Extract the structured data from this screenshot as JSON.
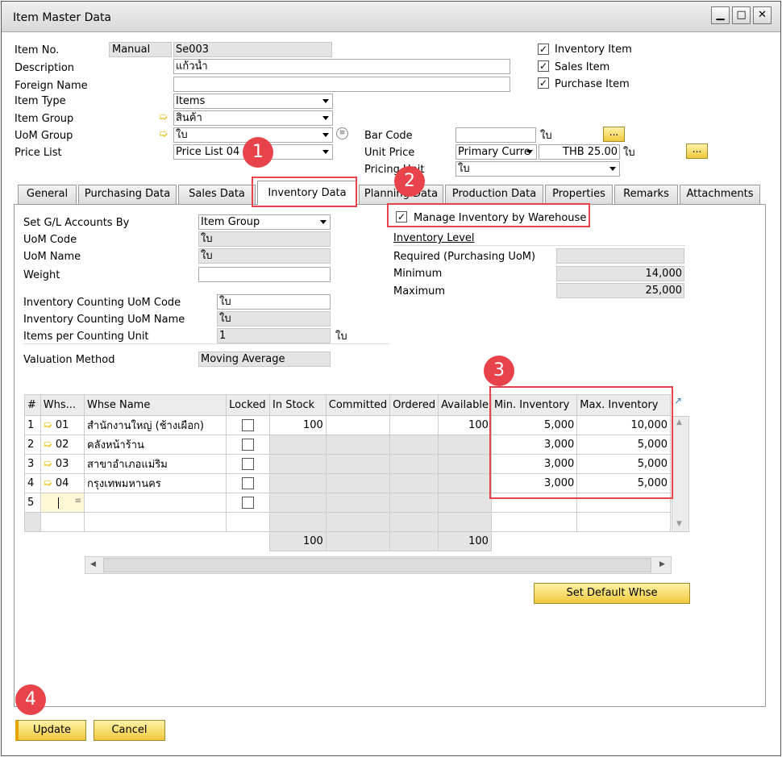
{
  "window": {
    "title": "Item Master Data"
  },
  "header": {
    "item_no_label": "Item No.",
    "item_no_series": "Manual",
    "item_no": "Se003",
    "description_label": "Description",
    "description": "แก้วน้ำ",
    "foreign_name_label": "Foreign Name",
    "foreign_name": "",
    "item_type_label": "Item Type",
    "item_type": "Items",
    "item_group_label": "Item Group",
    "item_group": "สินค้า",
    "uom_group_label": "UoM Group",
    "uom_group": "ใบ",
    "price_list_label": "Price List",
    "price_list": "Price List 04",
    "bar_code_label": "Bar Code",
    "bar_code": "",
    "bar_code_unit": "ใบ",
    "unit_price_label": "Unit Price",
    "unit_price_currency": "Primary Curre",
    "unit_price": "THB 25.00",
    "unit_price_unit": "ใบ",
    "pricing_unit_label": "Pricing Unit",
    "pricing_unit": "ใบ",
    "ellipsis": "...",
    "inventory_item_label": "Inventory Item",
    "sales_item_label": "Sales Item",
    "purchase_item_label": "Purchase Item"
  },
  "tabs": [
    "General",
    "Purchasing Data",
    "Sales Data",
    "Inventory Data",
    "Planning Data",
    "Production Data",
    "Properties",
    "Remarks",
    "Attachments"
  ],
  "inventory": {
    "set_gl_label": "Set G/L Accounts By",
    "set_gl": "Item Group",
    "uom_code_label": "UoM Code",
    "uom_code": "ใบ",
    "uom_name_label": "UoM Name",
    "uom_name": "ใบ",
    "weight_label": "Weight",
    "weight": "",
    "count_uom_code_label": "Inventory Counting UoM Code",
    "count_uom_code": "ใบ",
    "count_uom_name_label": "Inventory Counting UoM Name",
    "count_uom_name": "ใบ",
    "items_per_count_label": "Items per Counting Unit",
    "items_per_count": "1",
    "items_per_count_unit": "ใบ",
    "valuation_label": "Valuation Method",
    "valuation": "Moving Average",
    "manage_by_whse_label": "Manage Inventory by Warehouse",
    "level_label": "Inventory Level",
    "required_label": "Required (Purchasing UoM)",
    "required": "",
    "minimum_label": "Minimum",
    "minimum": "14,000",
    "maximum_label": "Maximum",
    "maximum": "25,000"
  },
  "grid": {
    "columns": [
      "#",
      "Whs...",
      "Whse Name",
      "Locked",
      "In Stock",
      "Committed",
      "Ordered",
      "Available",
      "Min. Inventory",
      "Max. Inventory"
    ],
    "rows": [
      {
        "n": "1",
        "code": "01",
        "name": "สำนักงานใหญ่ (ช้างเผือก)",
        "in_stock": "100",
        "available": "100",
        "min": "5,000",
        "max": "10,000"
      },
      {
        "n": "2",
        "code": "02",
        "name": "คลังหน้าร้าน",
        "in_stock": "",
        "available": "",
        "min": "3,000",
        "max": "5,000"
      },
      {
        "n": "3",
        "code": "03",
        "name": "สาขาอำเภอแม่ริม",
        "in_stock": "",
        "available": "",
        "min": "3,000",
        "max": "5,000"
      },
      {
        "n": "4",
        "code": "04",
        "name": "กรุงเทพมหานคร",
        "in_stock": "",
        "available": "",
        "min": "3,000",
        "max": "5,000"
      },
      {
        "n": "5",
        "code": "",
        "name": "",
        "in_stock": "",
        "available": "",
        "min": "",
        "max": ""
      }
    ],
    "totals": {
      "in_stock": "100",
      "available": "100"
    }
  },
  "buttons": {
    "set_default_whse": "Set Default Whse",
    "update": "Update",
    "cancel": "Cancel"
  },
  "badges": [
    "1",
    "2",
    "3",
    "4"
  ]
}
